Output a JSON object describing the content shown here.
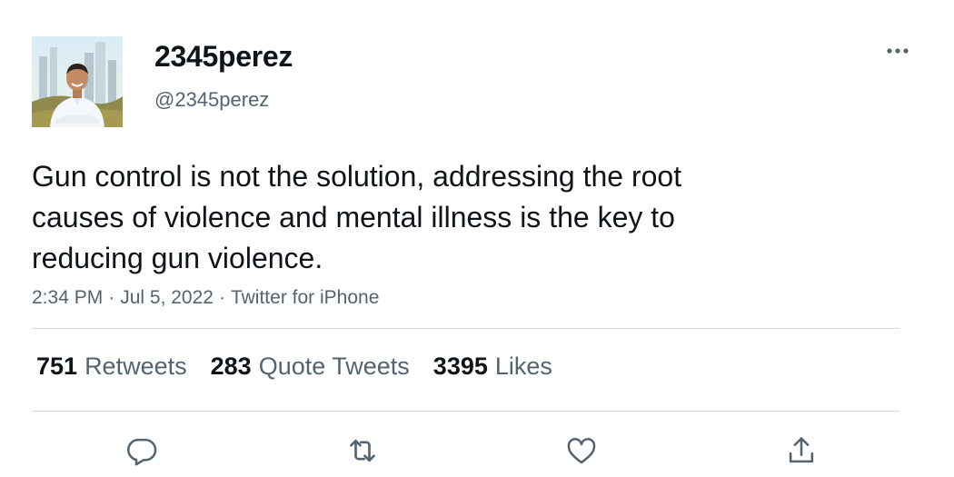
{
  "tweet": {
    "display_name": "2345perez",
    "handle": "@2345perez",
    "text_lines": [
      "Gun control is not the solution, addressing the root",
      "causes of violence and mental illness is the key to",
      "reducing gun violence."
    ],
    "meta": {
      "time": "2:34 PM",
      "date": "Jul 5, 2022",
      "source": "Twitter for iPhone",
      "separator": "·"
    },
    "stats": {
      "retweets": {
        "count": "751",
        "label": "Retweets"
      },
      "quote_tweets": {
        "count": "283",
        "label": "Quote Tweets"
      },
      "likes": {
        "count": "3395",
        "label": "Likes"
      }
    },
    "actions": [
      "reply-icon",
      "retweet-icon",
      "like-icon",
      "share-icon"
    ],
    "colors": {
      "text": "#0f1419",
      "secondary": "#536471",
      "divider": "#cfd9de"
    }
  }
}
